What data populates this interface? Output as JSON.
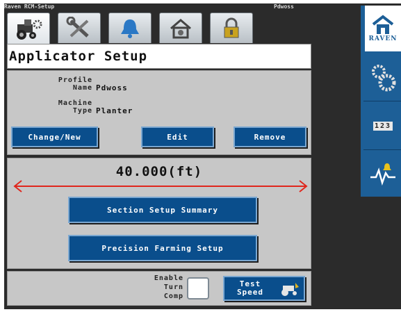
{
  "titlebar": {
    "left": "Raven RCM-Setup",
    "right": "Pdwoss"
  },
  "tabs": [
    {
      "name": "machine-setup",
      "icon": "tractor-gear-icon",
      "active": true
    },
    {
      "name": "tools",
      "icon": "wrench-screwdriver-icon",
      "active": false
    },
    {
      "name": "alarms",
      "icon": "bell-icon",
      "active": false
    },
    {
      "name": "system",
      "icon": "house-gear-icon",
      "active": false
    },
    {
      "name": "security",
      "icon": "lock-icon",
      "active": false
    }
  ],
  "header": {
    "title": "Applicator Setup"
  },
  "profile": {
    "profile_label_line1": "Profile",
    "profile_label_line2": "Name",
    "profile_value": "Pdwoss",
    "machine_label_line1": "Machine",
    "machine_label_line2": "Type",
    "machine_value": "Planter"
  },
  "buttons": {
    "change_new": "Change/New",
    "edit": "Edit",
    "remove": "Remove",
    "section_summary": "Section Setup Summary",
    "precision_farming": "Precision Farming Setup",
    "test_speed_line1": "Test",
    "test_speed_line2": "Speed"
  },
  "implement": {
    "width": "40.000(ft)"
  },
  "turn_comp": {
    "label_line1": "Enable",
    "label_line2": "Turn",
    "label_line3": "Comp",
    "checked": false
  },
  "sidebar": {
    "logo_text": "RAVEN",
    "counter_text": "123",
    "items": [
      "home-icon",
      "gears-icon",
      "counter-icon",
      "diagnostics-icon"
    ]
  },
  "colors": {
    "button_blue": "#0a4e8c",
    "panel_gray": "#c7c7c7",
    "sidebar_blue": "#1d5f97",
    "width_arrow_red": "#e0261c"
  }
}
